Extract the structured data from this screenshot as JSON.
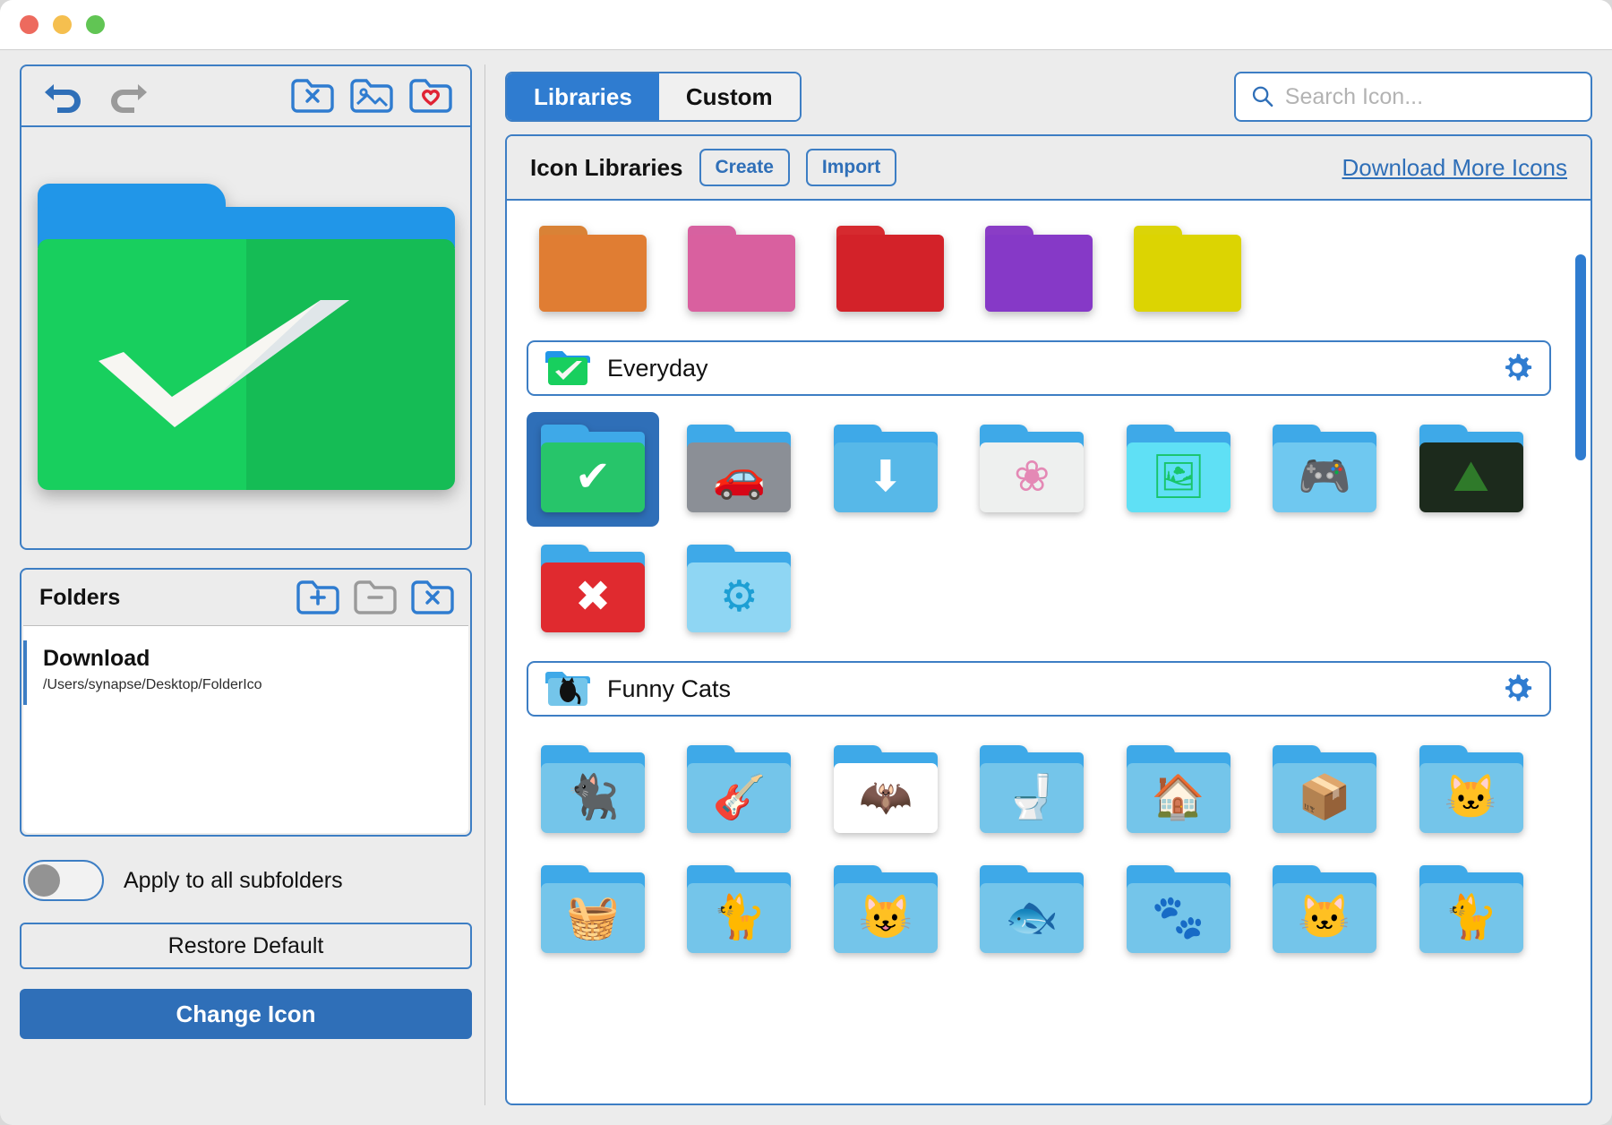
{
  "window": {
    "traffic_lights": [
      "close",
      "minimize",
      "zoom"
    ]
  },
  "left_panel": {
    "toolbar": {
      "undo": "undo-arrow",
      "redo": "redo-arrow",
      "remove_icon": "folder-x",
      "image_folder": "folder-image",
      "favorite_folder": "folder-heart"
    },
    "preview": {
      "icon_name": "green-check-folder"
    },
    "folders": {
      "title": "Folders",
      "actions": {
        "add": "folder-plus",
        "remove": "folder-minus",
        "clear": "folder-x"
      },
      "items": [
        {
          "name": "Download",
          "path": "/Users/synapse/Desktop/FolderIco",
          "selected": true
        }
      ]
    },
    "apply_all_label": "Apply to all subfolders",
    "apply_all_on": false,
    "restore_default_label": "Restore Default",
    "change_icon_label": "Change Icon"
  },
  "right_panel": {
    "tabs": [
      {
        "label": "Libraries",
        "active": true
      },
      {
        "label": "Custom",
        "active": false
      }
    ],
    "search": {
      "placeholder": "Search Icon...",
      "value": "",
      "icon": "search-icon"
    },
    "content_header": {
      "title": "Icon Libraries",
      "create_label": "Create",
      "import_label": "Import",
      "download_link": "Download More Icons"
    },
    "color_swatches": [
      {
        "name": "orange",
        "tab": "#d98236",
        "body": "#e07d33"
      },
      {
        "name": "pink",
        "tab": "#d761a0",
        "body": "#d9609f"
      },
      {
        "name": "red",
        "tab": "#d62a2f",
        "body": "#d32229"
      },
      {
        "name": "purple",
        "tab": "#8a3dc6",
        "body": "#8639c7"
      },
      {
        "name": "yellow",
        "tab": "#dbd408",
        "body": "#dcd402"
      }
    ],
    "libraries": [
      {
        "name": "Everyday",
        "badge_icon": "green-check-folder",
        "gear": "gear-icon",
        "icons": [
          {
            "name": "check",
            "glyph": "✔",
            "fg": "#ffffff",
            "bg": "#27c56a",
            "selected": true
          },
          {
            "name": "car",
            "glyph": "🚗",
            "fg": "#2a2a2a",
            "bg": "#8b8f96",
            "selected": false
          },
          {
            "name": "download",
            "glyph": "⬇",
            "fg": "#ffffff",
            "bg": "#57b8e8",
            "selected": false
          },
          {
            "name": "flowers",
            "glyph": "❀",
            "fg": "#e489b5",
            "bg": "#eef0ef",
            "selected": false
          },
          {
            "name": "pictures",
            "glyph": "🖼",
            "fg": "#18c46a",
            "bg": "#5fe0f5",
            "selected": false
          },
          {
            "name": "games",
            "glyph": "🎮",
            "fg": "#f2f4f7",
            "bg": "#6fc8f0",
            "selected": false
          },
          {
            "name": "landscape",
            "glyph": "⛰",
            "fg": "#2f7a2a",
            "bg": "#1c2a1c",
            "selected": false
          },
          {
            "name": "delete",
            "glyph": "✖",
            "fg": "#ffffff",
            "bg": "#e02a2f",
            "selected": false
          },
          {
            "name": "settings",
            "glyph": "⚙",
            "fg": "#1d9fd4",
            "bg": "#8fd6f3",
            "selected": false
          }
        ]
      },
      {
        "name": "Funny Cats",
        "badge_icon": "black-cat-folder",
        "gear": "gear-icon",
        "icons": [
          {
            "name": "black-cat",
            "glyph": "🐈‍⬛",
            "fg": "#111111",
            "bg": "#74c5ea",
            "selected": false
          },
          {
            "name": "guitar-cat",
            "glyph": "🎸",
            "fg": "#6f6f78",
            "bg": "#74c5ea",
            "selected": false
          },
          {
            "name": "bat-cat",
            "glyph": "🦇",
            "fg": "#111111",
            "bg": "#ffffff",
            "selected": false
          },
          {
            "name": "toilet-cat",
            "glyph": "🚽",
            "fg": "#8a8f96",
            "bg": "#74c5ea",
            "selected": false
          },
          {
            "name": "house-cat",
            "glyph": "🏠",
            "fg": "#c8a06a",
            "bg": "#74c5ea",
            "selected": false
          },
          {
            "name": "box-cat",
            "glyph": "📦",
            "fg": "#4a8f5a",
            "bg": "#74c5ea",
            "selected": false
          },
          {
            "name": "ball-cat",
            "glyph": "🐱",
            "fg": "#e09040",
            "bg": "#74c5ea",
            "selected": false
          },
          {
            "name": "laundry-cat",
            "glyph": "🧺",
            "fg": "#c62b3a",
            "bg": "#74c5ea",
            "selected": false
          },
          {
            "name": "gray-cat",
            "glyph": "🐈",
            "fg": "#8a8f96",
            "bg": "#74c5ea",
            "selected": false
          },
          {
            "name": "fluffy-cat",
            "glyph": "😺",
            "fg": "#ded7c8",
            "bg": "#74c5ea",
            "selected": false
          },
          {
            "name": "goldfish-cat",
            "glyph": "🐟",
            "fg": "#e08030",
            "bg": "#74c5ea",
            "selected": false
          },
          {
            "name": "pink-cat",
            "glyph": "🐾",
            "fg": "#e860a8",
            "bg": "#74c5ea",
            "selected": false
          },
          {
            "name": "white-cat",
            "glyph": "🐱",
            "fg": "#efefef",
            "bg": "#74c5ea",
            "selected": false
          },
          {
            "name": "orange-cat",
            "glyph": "🐈",
            "fg": "#e8913c",
            "bg": "#74c5ea",
            "selected": false
          }
        ]
      }
    ],
    "scrollbar": {
      "name": "vertical-scrollbar"
    }
  },
  "colors": {
    "accent": "#2f7cd0",
    "border": "#3d7ec4",
    "primary_button": "#2f6fb8",
    "link": "#2f6fb8"
  }
}
